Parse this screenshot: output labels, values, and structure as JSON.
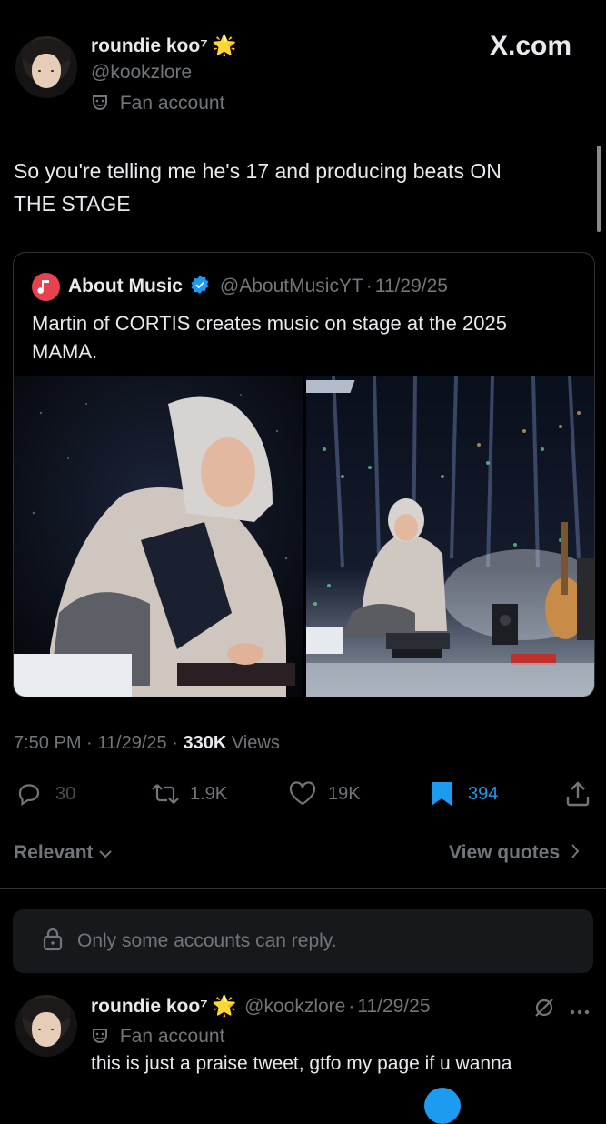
{
  "header": {
    "display_name": "roundie koo⁷",
    "handle": "@kookzlore",
    "label": "Fan account",
    "site": "X.com"
  },
  "tweet": {
    "text_line1": "So you're telling me he's 17 and producing beats ON",
    "text_line2": "THE STAGE"
  },
  "quote": {
    "name": "About Music",
    "handle": "@AboutMusicYT",
    "date": "11/29/25",
    "separator": "·",
    "text_line1": "Martin of CORTIS creates music on stage at the 2025",
    "text_line2": "MAMA."
  },
  "meta": {
    "time": "7:50 PM",
    "date": "11/29/25",
    "separator": "·",
    "views_count": "330K",
    "views_label": "Views"
  },
  "actions": {
    "replies": "30",
    "reposts": "1.9K",
    "likes": "19K",
    "bookmarks": "394"
  },
  "filter": {
    "sort": "Relevant",
    "view_quotes": "View quotes"
  },
  "reply_notice": "Only some accounts can reply.",
  "reply": {
    "display_name": "roundie koo⁷",
    "handle": "@kookzlore",
    "separator": "·",
    "date": "11/29/25",
    "label": "Fan account",
    "text": "this is just a praise tweet, gtfo my page if u wanna"
  },
  "colors": {
    "background": "#000000",
    "text": "#e7e9ea",
    "secondary": "#71767b",
    "accent": "#1d9bf0",
    "verified": "#1d9bf0",
    "star": "#f4c542"
  }
}
